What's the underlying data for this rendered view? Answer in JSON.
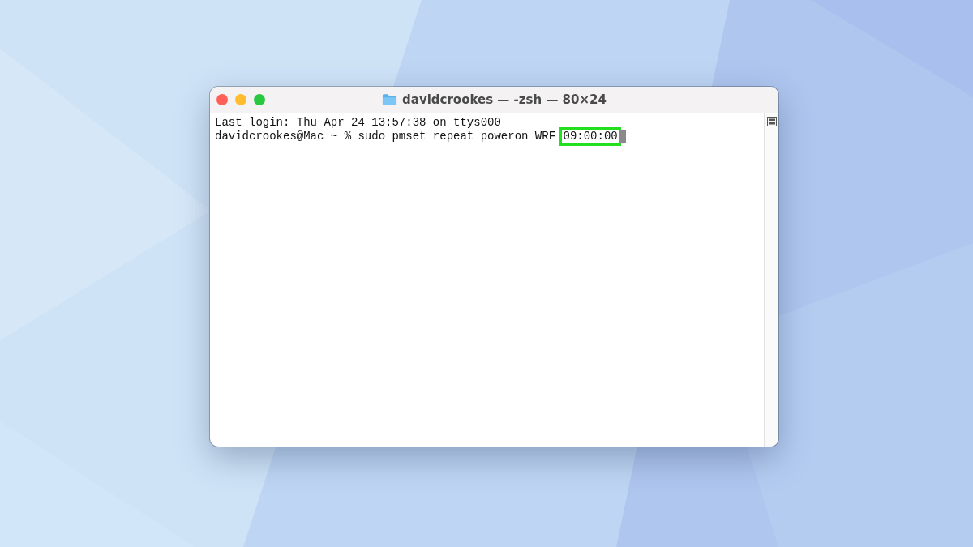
{
  "window": {
    "title": "davidcrookes — -zsh — 80×24"
  },
  "terminal": {
    "lines": [
      {
        "segments": [
          {
            "kind": "plain",
            "text": "Last login: Thu Apr 24 13:57:38 on ttys000"
          }
        ]
      },
      {
        "segments": [
          {
            "kind": "plain",
            "text": "davidcrookes@Mac ~ % sudo pmset repeat poweron WRF "
          },
          {
            "kind": "highlighted",
            "text": "09:00:00"
          }
        ],
        "cursor": true
      }
    ]
  }
}
